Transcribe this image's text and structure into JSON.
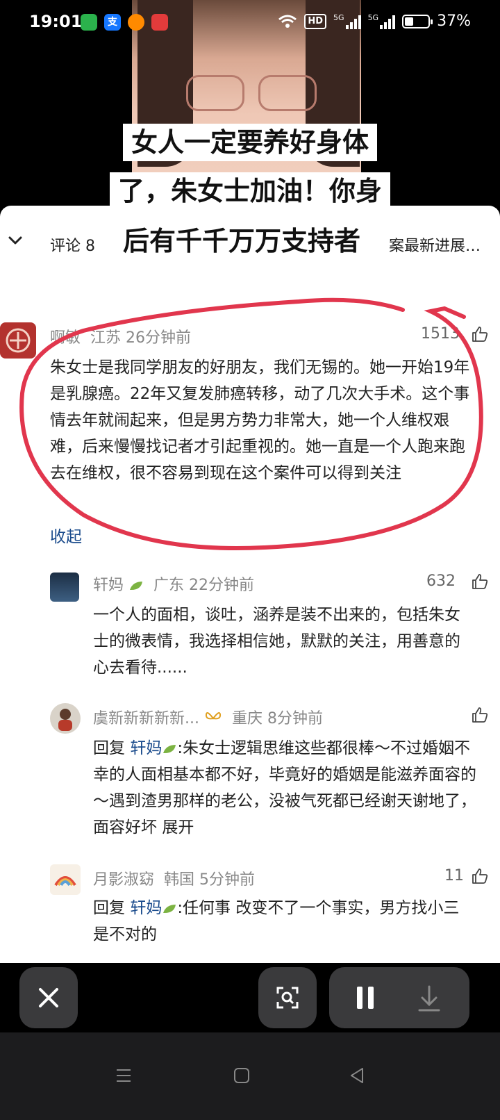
{
  "status_bar": {
    "time": "19:01",
    "apps": [
      {
        "name": "wechat-icon",
        "label": "",
        "color": "#2bb24c"
      },
      {
        "name": "alipay-icon",
        "label": "支",
        "color": "#1677ff"
      },
      {
        "name": "app-orange-icon",
        "label": "",
        "color": "#ff8a00"
      },
      {
        "name": "app-red-icon",
        "label": "",
        "color": "#e23b3b"
      }
    ],
    "hd_label": "HD",
    "network_1": "5G",
    "network_2": "5G",
    "battery": "37%",
    "battery_level": 0.37
  },
  "video": {
    "caption_lines": [
      "女人一定要养好身体",
      "了，朱女士加油！你身",
      "后有千千万万支持者"
    ]
  },
  "comments_sheet": {
    "title": "评论 8",
    "related_link": "案最新进展…"
  },
  "comments": [
    {
      "user": "啊敏",
      "location": "江苏",
      "time": "26分钟前",
      "likes": "1513",
      "text": "朱女士是我同学朋友的好朋友，我们无锡的。她一开始19年是乳腺癌。22年又复发肺癌转移，动了几次大手术。这个事情去年就闹起来，但是男方势力非常大，她一个人维权艰难，后来慢慢找记者才引起重视的。她一直是一个人跑来跑去在维权，很不容易到现在这个案件可以得到关注",
      "collapse": "收起"
    },
    {
      "user": "轩妈",
      "location": "广东",
      "time": "22分钟前",
      "likes": "632",
      "text": "一个人的面相，谈吐，涵养是装不出来的，包括朱女士的微表情，我选择相信她，默默的关注，用善意的心去看待......"
    },
    {
      "user": "虞新新新新新...",
      "location": "重庆",
      "time": "8分钟前",
      "likes": "",
      "reply_prefix": "回复",
      "reply_to": "轩妈",
      "text": ":朱女士逻辑思维这些都很棒～不过婚姻不幸的人面相基本都不好，毕竟好的婚姻是能滋养面容的～遇到渣男那样的老公，没被气死都已经谢天谢地了，面容好坏",
      "expand": "展开"
    },
    {
      "user": "月影淑窈",
      "location": "韩国",
      "time": "5分钟前",
      "likes": "11",
      "reply_prefix": "回复",
      "reply_to": "轩妈",
      "text": ":任何事 改变不了一个事实，男方找小三 是不对的"
    }
  ],
  "bottom_bar": {
    "close": "close-icon",
    "scan": "scan-icon",
    "pause": "pause-icon",
    "download": "download-icon"
  }
}
